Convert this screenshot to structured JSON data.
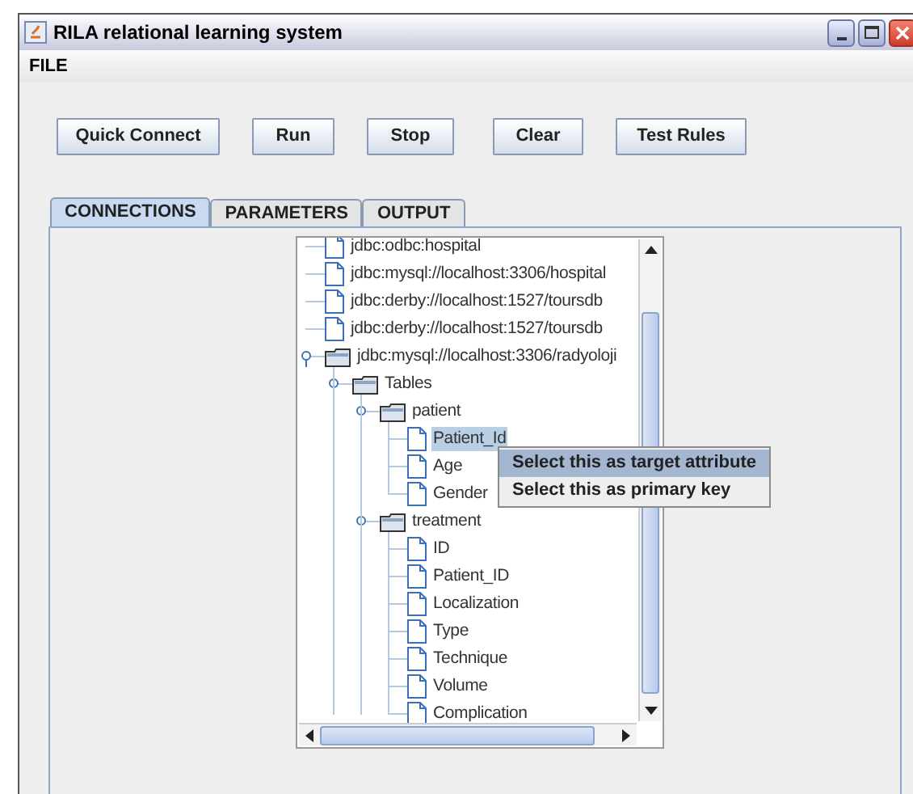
{
  "window": {
    "title": "RILA relational learning system"
  },
  "menu": [
    "FILE"
  ],
  "buttons": [
    "Quick Connect",
    "Run",
    "Stop",
    "Clear",
    "Test Rules"
  ],
  "tabs": [
    {
      "label": "CONNECTIONS",
      "selected": true
    },
    {
      "label": "PARAMETERS",
      "selected": false
    },
    {
      "label": "OUTPUT",
      "selected": false
    }
  ],
  "tree": [
    {
      "label": "jdbc:odbc:hospital",
      "kind": "file",
      "selected": false
    },
    {
      "label": "jdbc:mysql://localhost:3306/hospital",
      "kind": "file",
      "selected": false
    },
    {
      "label": "jdbc:derby://localhost:1527/toursdb",
      "kind": "file",
      "selected": false
    },
    {
      "label": "jdbc:derby://localhost:1527/toursdb",
      "kind": "file",
      "selected": false
    },
    {
      "label": "jdbc:mysql://localhost:3306/radyoloji",
      "kind": "folder",
      "expanded": true,
      "selected": false,
      "children": [
        {
          "label": "Tables",
          "kind": "folder",
          "expanded": true,
          "selected": false,
          "children": [
            {
              "label": "patient",
              "kind": "folder",
              "expanded": true,
              "selected": false,
              "children": [
                {
                  "label": "Patient_Id",
                  "kind": "file",
                  "selected": true
                },
                {
                  "label": "Age",
                  "kind": "file",
                  "selected": false
                },
                {
                  "label": "Gender",
                  "kind": "file",
                  "selected": false
                }
              ]
            },
            {
              "label": "treatment",
              "kind": "folder",
              "expanded": true,
              "selected": false,
              "children": [
                {
                  "label": "ID",
                  "kind": "file",
                  "selected": false
                },
                {
                  "label": "Patient_ID",
                  "kind": "file",
                  "selected": false
                },
                {
                  "label": "Localization",
                  "kind": "file",
                  "selected": false
                },
                {
                  "label": "Type",
                  "kind": "file",
                  "selected": false
                },
                {
                  "label": "Technique",
                  "kind": "file",
                  "selected": false
                },
                {
                  "label": "Volume",
                  "kind": "file",
                  "selected": false
                },
                {
                  "label": "Complication",
                  "kind": "file",
                  "selected": false
                }
              ]
            }
          ]
        }
      ]
    }
  ],
  "context_menu": [
    {
      "label": "Select this as target attribute",
      "selected": true
    },
    {
      "label": "Select this as primary key",
      "selected": false
    }
  ]
}
